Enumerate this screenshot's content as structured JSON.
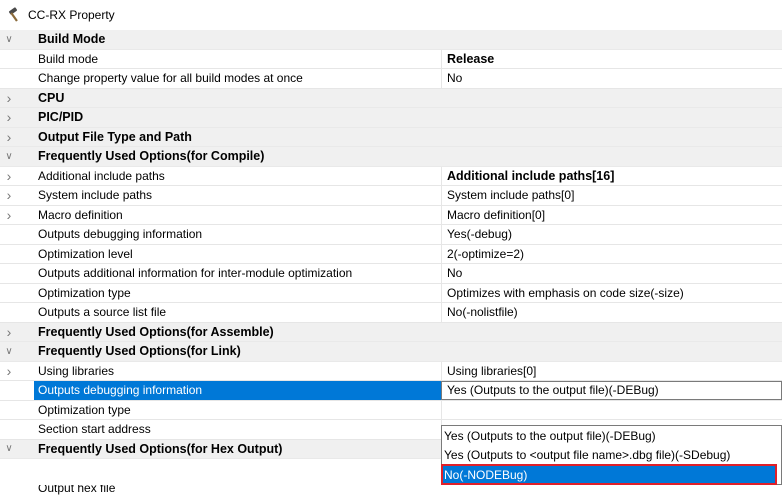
{
  "window": {
    "title": "CC-RX Property"
  },
  "rows": [
    {
      "type": "category",
      "expander": "down",
      "name": "Build Mode"
    },
    {
      "type": "prop",
      "expander": "",
      "name": "Build mode",
      "value": "Release",
      "bold": true
    },
    {
      "type": "prop",
      "expander": "",
      "name": "Change property value for all build modes at once",
      "value": "No"
    },
    {
      "type": "category",
      "expander": "right",
      "name": "CPU"
    },
    {
      "type": "category",
      "expander": "right",
      "name": "PIC/PID"
    },
    {
      "type": "category",
      "expander": "right",
      "name": "Output File Type and Path"
    },
    {
      "type": "category",
      "expander": "down",
      "name": "Frequently Used Options(for Compile)"
    },
    {
      "type": "prop",
      "expander": "right",
      "name": "Additional include paths",
      "value": "Additional include paths[16]",
      "bold": true
    },
    {
      "type": "prop",
      "expander": "right",
      "name": "System include paths",
      "value": "System include paths[0]"
    },
    {
      "type": "prop",
      "expander": "right",
      "name": "Macro definition",
      "value": "Macro definition[0]"
    },
    {
      "type": "prop",
      "expander": "",
      "name": "Outputs debugging information",
      "value": "Yes(-debug)"
    },
    {
      "type": "prop",
      "expander": "",
      "name": "Optimization level",
      "value": "2(-optimize=2)"
    },
    {
      "type": "prop",
      "expander": "",
      "name": "Outputs additional information for inter-module optimization",
      "value": "No"
    },
    {
      "type": "prop",
      "expander": "",
      "name": "Optimization type",
      "value": "Optimizes with emphasis on code size(-size)"
    },
    {
      "type": "prop",
      "expander": "",
      "name": "Outputs a source list file",
      "value": "No(-nolistfile)"
    },
    {
      "type": "category",
      "expander": "right",
      "name": "Frequently Used Options(for Assemble)"
    },
    {
      "type": "category",
      "expander": "down",
      "name": "Frequently Used Options(for Link)"
    },
    {
      "type": "prop",
      "expander": "right",
      "name": "Using libraries",
      "value": "Using libraries[0]"
    },
    {
      "type": "prop",
      "expander": "",
      "name": "Outputs debugging information",
      "value": "Yes (Outputs to the output file)(-DEBug)",
      "selected": true
    },
    {
      "type": "prop",
      "expander": "",
      "name": "Optimization type",
      "value": ""
    },
    {
      "type": "prop",
      "expander": "",
      "name": "Section start address",
      "value": ""
    },
    {
      "type": "category",
      "expander": "down",
      "name": "Frequently Used Options(for Hex Output)"
    }
  ],
  "partial_row": {
    "name": "Output hex file"
  },
  "dropdown": {
    "options": [
      "Yes (Outputs to the output file)(-DEBug)",
      "Yes (Outputs to <output file name>.dbg file)(-SDebug)",
      "No(-NODEBug)"
    ],
    "highlighted_index": 2
  }
}
